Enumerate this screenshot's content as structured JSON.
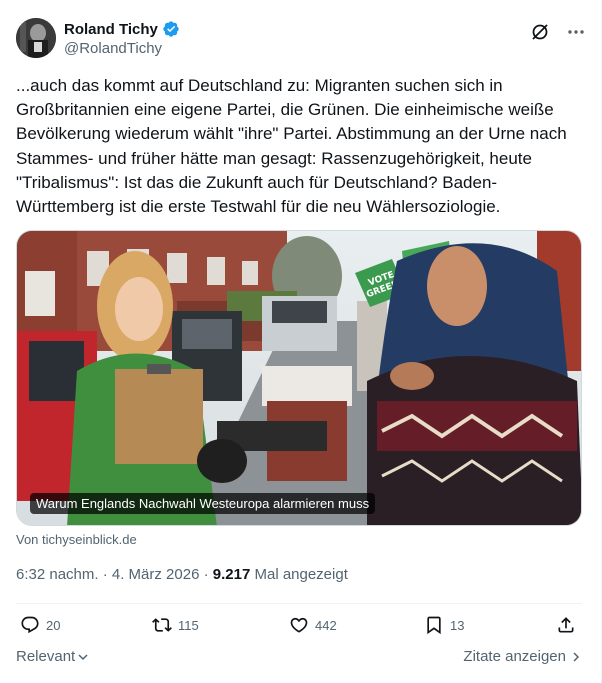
{
  "author": {
    "display_name": "Roland Tichy",
    "handle": "@RolandTichy",
    "verified_icon": "verified-badge-icon"
  },
  "header_actions": [
    "grok-icon",
    "more-icon"
  ],
  "tweet": {
    "text": "...auch das kommt auf Deutschland zu: Migranten suchen sich in Großbritannien eine eigene Partei, die Grünen. Die einheimische weiße Bevölkerung wiederum wählt \"ihre\" Partei. Abstimmung an der Urne nach Stammes- und früher hätte man gesagt: Rassenzugehörigkeit, heute \"Tribalismus\": Ist das die Zukunft auch für Deutschland? Baden-Württemberg ist die erste Testwahl für die neu Wählersoziologie."
  },
  "media": {
    "caption": "Warum Englands Nachwahl Westeuropa alarmieren muss",
    "sign_text_1": "VOTE",
    "sign_text_2": "GREEN",
    "sign_text_3": "Gr"
  },
  "source": "Von tichyseinblick.de",
  "meta": {
    "time_date": "6:32 nachm. · 4. März 2026 · ",
    "views_count": "9.217",
    "views_label": " Mal angezeigt"
  },
  "actions": {
    "replies": "20",
    "reposts": "115",
    "likes": "442",
    "bookmarks": "13"
  },
  "footer": {
    "sort_label": "Relevant",
    "quotes_label": "Zitate anzeigen"
  },
  "colors": {
    "accent": "#1d9bf0",
    "text_primary": "#0f1419",
    "text_secondary": "#536471"
  }
}
